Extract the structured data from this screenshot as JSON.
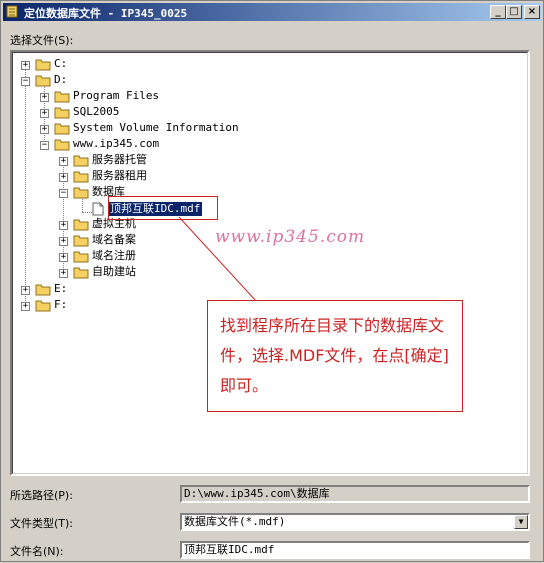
{
  "window": {
    "title": "定位数据库文件 - IP345_0025",
    "controls": {
      "minimize": "_",
      "maximize": "□",
      "close": "×"
    }
  },
  "select_file_label": "选择文件(S):",
  "tree": {
    "c_drive": "C:",
    "d_drive": "D:",
    "program_files": "Program Files",
    "sql2005": "SQL2005",
    "system_volume": "System Volume Information",
    "ip345": "www.ip345.com",
    "hosting": "服务器托管",
    "rental": "服务器租用",
    "database": "数据库",
    "mdf_file": "顶邦互联IDC.mdf",
    "virtual_host": "虚拟主机",
    "domain_record": "域名备案",
    "domain_register": "域名注册",
    "self_build": "自助建站",
    "e_drive": "E:",
    "f_drive": "F:"
  },
  "watermark": "www.ip345.com",
  "callout_text": "找到程序所在目录下的数据库文件，选择.MDF文件，在点[确定]即可。",
  "path_label": "所选路径(P):",
  "path_value": "D:\\www.ip345.com\\数据库",
  "type_label": "文件类型(T):",
  "type_value": "数据库文件(*.mdf)",
  "name_label": "文件名(N):",
  "name_value": "顶邦互联IDC.mdf",
  "colors": {
    "title_start": "#0a246a",
    "title_end": "#a6caf0",
    "annotation_red": "#cc2222",
    "watermark_pink": "#e070a0",
    "selection": "#0a246a"
  },
  "icons": {
    "title_icon": "database-icon",
    "folder": "folder-icon",
    "file": "file-icon"
  }
}
